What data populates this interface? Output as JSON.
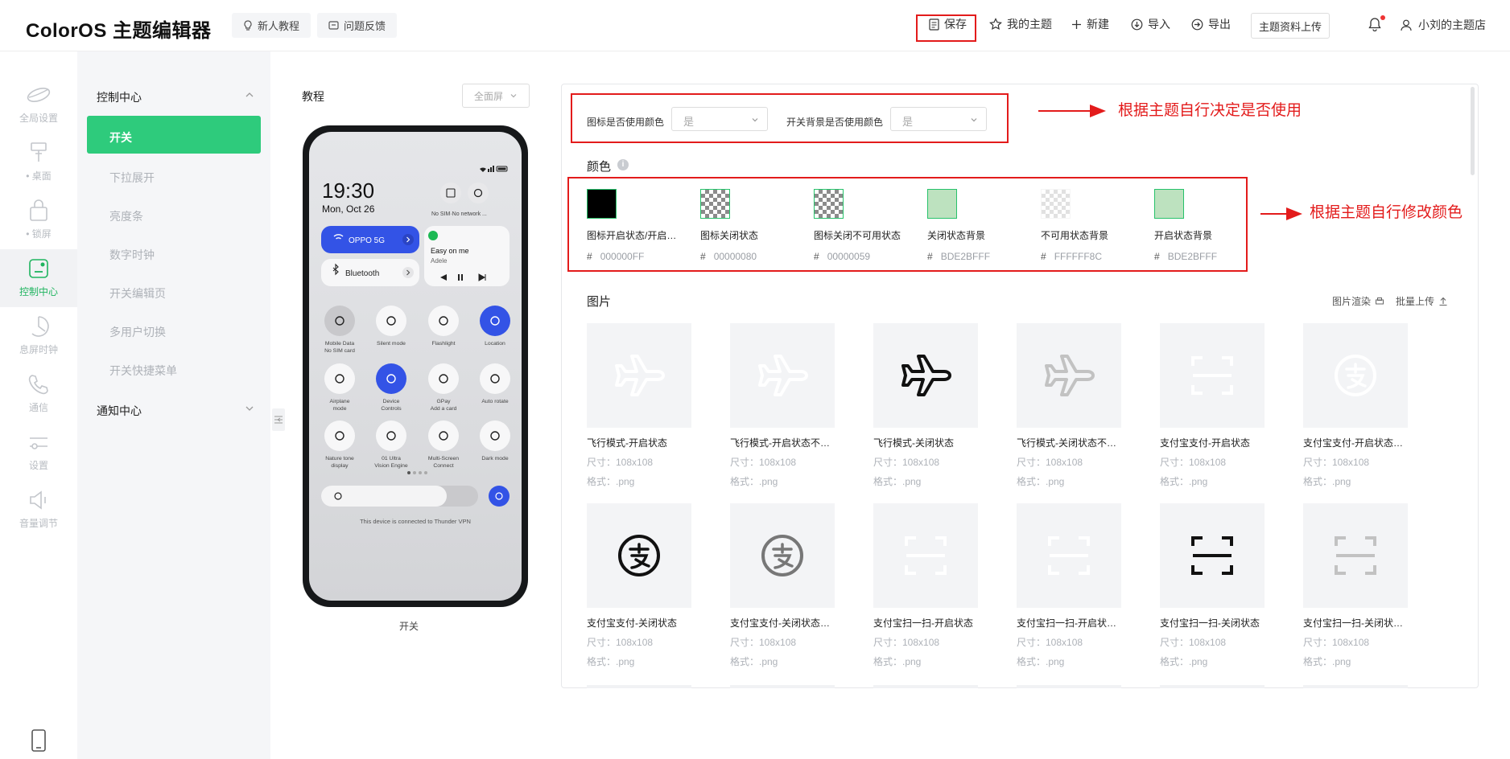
{
  "app": {
    "title": "ColorOS 主题编辑器"
  },
  "topbar": {
    "guide": "新人教程",
    "feedback": "问题反馈",
    "save": "保存",
    "my_themes": "我的主题",
    "new": "新建",
    "import": "导入",
    "export": "导出",
    "upload": "主题资料上传",
    "store": "小刘的主题店"
  },
  "rail": [
    {
      "label": "全局设置",
      "icon": "globe-icon"
    },
    {
      "label": "• 桌面",
      "icon": "brush-icon"
    },
    {
      "label": "• 锁屏",
      "icon": "lock-icon"
    },
    {
      "label": "控制中心",
      "icon": "control-center-icon"
    },
    {
      "label": "息屏时钟",
      "icon": "clock-icon"
    },
    {
      "label": "通信",
      "icon": "phone-icon"
    },
    {
      "label": "设置",
      "icon": "settings-slider-icon"
    },
    {
      "label": "音量调节",
      "icon": "volume-icon"
    }
  ],
  "sidebar": {
    "group1": "控制中心",
    "active": "开关",
    "items": [
      "下拉展开",
      "亮度条",
      "数字时钟",
      "开关编辑页",
      "多用户切换",
      "开关快捷菜单"
    ],
    "group2": "通知中心"
  },
  "preview": {
    "title": "教程",
    "fullscreen": "全面屏",
    "caption": "开关",
    "time": "19:30",
    "date": "Mon, Oct 26",
    "sim": "No SIM·No network ...",
    "wifi": "OPPO 5G",
    "bluetooth": "Bluetooth",
    "song": "Easy on me",
    "artist": "Adele",
    "tiles": [
      {
        "label": "Mobile Data\nNo SIM card"
      },
      {
        "label": "Silent mode"
      },
      {
        "label": "Flashlight"
      },
      {
        "label": "Location"
      },
      {
        "label": "Airplane\nmode"
      },
      {
        "label": "Device\nControls"
      },
      {
        "label": "GPay\nAdd a card"
      },
      {
        "label": "Auto rotate"
      },
      {
        "label": "Nature tone\ndisplay"
      },
      {
        "label": "01 Ultra\nVision Engine"
      },
      {
        "label": "Multi-Screen\nConnect"
      },
      {
        "label": "Dark mode"
      }
    ],
    "vpn": "This device is connected to Thunder VPN"
  },
  "settings": {
    "icon_color_label": "图标是否使用颜色",
    "icon_color_value": "是",
    "bg_color_label": "开关背景是否使用颜色",
    "bg_color_value": "是"
  },
  "annotations": {
    "top": "根据主题自行决定是否使用",
    "colors": "根据主题自行修改颜色"
  },
  "colors": {
    "title": "颜色",
    "items": [
      {
        "name": "图标开启状态/开启状态",
        "hex": "000000FF",
        "swatch": "#000000"
      },
      {
        "name": "图标关闭状态",
        "hex": "00000080",
        "swatch": "checker"
      },
      {
        "name": "图标关闭不可用状态",
        "hex": "00000059",
        "swatch": "checker"
      },
      {
        "name": "关闭状态背景",
        "hex": "BDE2BFFF",
        "swatch": "#BDE2BF"
      },
      {
        "name": "不可用状态背景",
        "hex": "FFFFFF8C",
        "swatch": "checker-light"
      },
      {
        "name": "开启状态背景",
        "hex": "BDE2BFFF",
        "swatch": "#BDE2BF"
      }
    ]
  },
  "images": {
    "title": "图片",
    "render": "图片渲染",
    "batch_upload": "批量上传",
    "items": [
      {
        "name": "飞行模式-开启状态",
        "size": "尺寸：108x108",
        "format": "格式：.png",
        "icon": "airplane-icon",
        "tone": "#ffffff"
      },
      {
        "name": "飞行模式-开启状态不可用",
        "size": "尺寸：108x108",
        "format": "格式：.png",
        "icon": "airplane-icon",
        "tone": "#ffffff"
      },
      {
        "name": "飞行模式-关闭状态",
        "size": "尺寸：108x108",
        "format": "格式：.png",
        "icon": "airplane-icon",
        "tone": "#111111"
      },
      {
        "name": "飞行模式-关闭状态不可用",
        "size": "尺寸：108x108",
        "format": "格式：.png",
        "icon": "airplane-icon",
        "tone": "#c2c2c2"
      },
      {
        "name": "支付宝支付-开启状态",
        "size": "尺寸：108x108",
        "format": "格式：.png",
        "icon": "scan-icon",
        "tone": "#ffffff"
      },
      {
        "name": "支付宝支付-开启状态不可用",
        "size": "尺寸：108x108",
        "format": "格式：.png",
        "icon": "alipay-icon",
        "tone": "#ffffff"
      },
      {
        "name": "支付宝支付-关闭状态",
        "size": "尺寸：108x108",
        "format": "格式：.png",
        "icon": "alipay-icon",
        "tone": "#111111"
      },
      {
        "name": "支付宝支付-关闭状态不可用",
        "size": "尺寸：108x108",
        "format": "格式：.png",
        "icon": "alipay-icon",
        "tone": "#777777"
      },
      {
        "name": "支付宝扫一扫-开启状态",
        "size": "尺寸：108x108",
        "format": "格式：.png",
        "icon": "scan-icon",
        "tone": "#ffffff"
      },
      {
        "name": "支付宝扫一扫-开启状态不可用",
        "size": "尺寸：108x108",
        "format": "格式：.png",
        "icon": "scan-icon",
        "tone": "#ffffff"
      },
      {
        "name": "支付宝扫一扫-关闭状态",
        "size": "尺寸：108x108",
        "format": "格式：.png",
        "icon": "scan-icon",
        "tone": "#111111"
      },
      {
        "name": "支付宝扫一扫-关闭状态不可用",
        "size": "尺寸：108x108",
        "format": "格式：.png",
        "icon": "scan-icon",
        "tone": "#c2c2c2"
      }
    ]
  },
  "theme": {
    "accent": "#2ecb7c",
    "annotation": "#e31b1b",
    "blue": "#2f4de0"
  }
}
